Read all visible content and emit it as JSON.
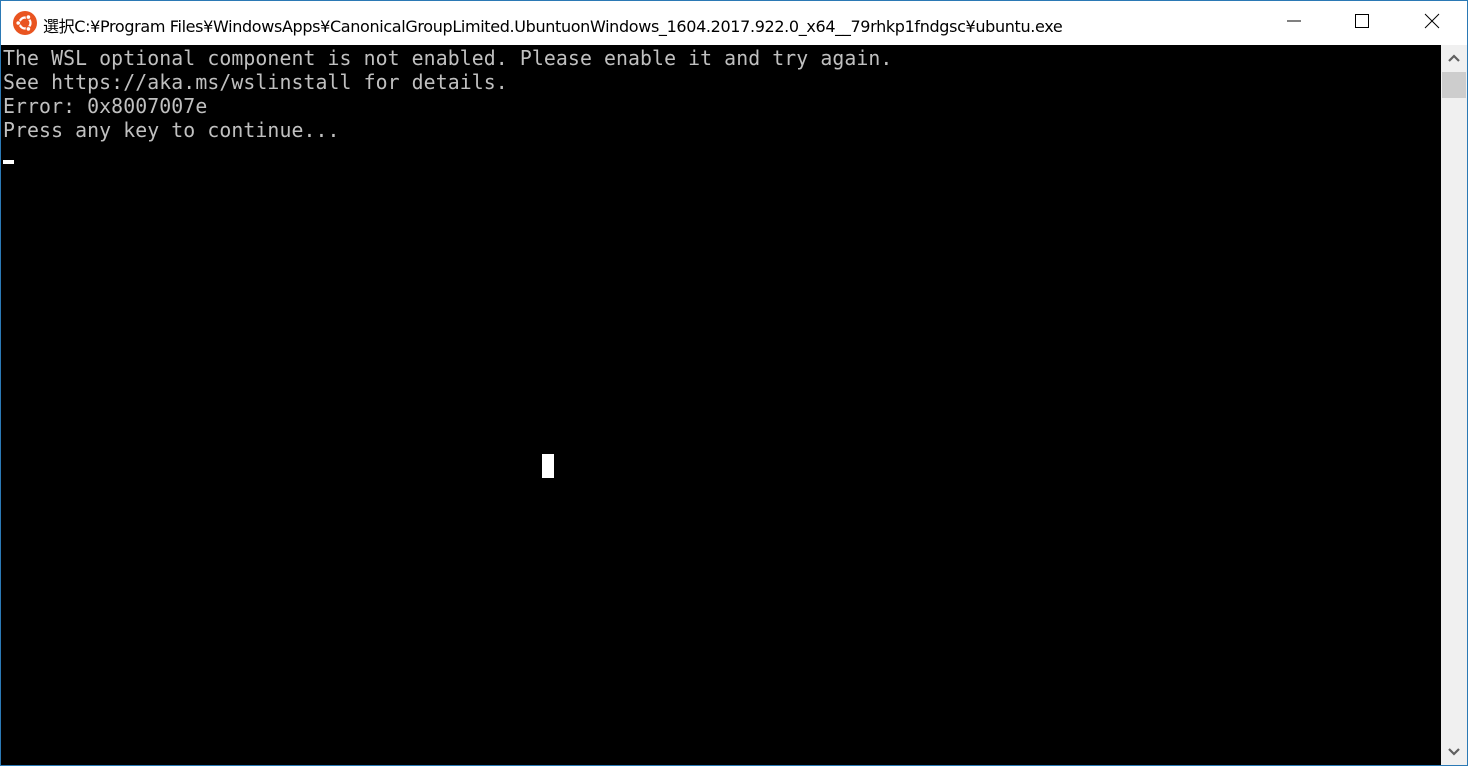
{
  "window": {
    "title": "選択C:¥Program Files¥WindowsApps¥CanonicalGroupLimited.UbuntuonWindows_1604.2017.922.0_x64__79rhkp1fndgsc¥ubuntu.exe",
    "app_icon": "ubuntu-logo-icon",
    "controls": {
      "minimize": "minimize-icon",
      "maximize": "maximize-icon",
      "close": "close-icon"
    }
  },
  "console": {
    "lines": [
      "The WSL optional component is not enabled. Please enable it and try again.",
      "See https://aka.ms/wslinstall for details.",
      "Error: 0x8007007e",
      "Press any key to continue..."
    ]
  },
  "scrollbar": {
    "up_icon": "chevron-up-icon",
    "down_icon": "chevron-down-icon"
  },
  "colors": {
    "accent_border": "#2b79b5",
    "console_bg": "#000000",
    "console_text": "#c0c0c0",
    "ubuntu_orange": "#e95420"
  }
}
